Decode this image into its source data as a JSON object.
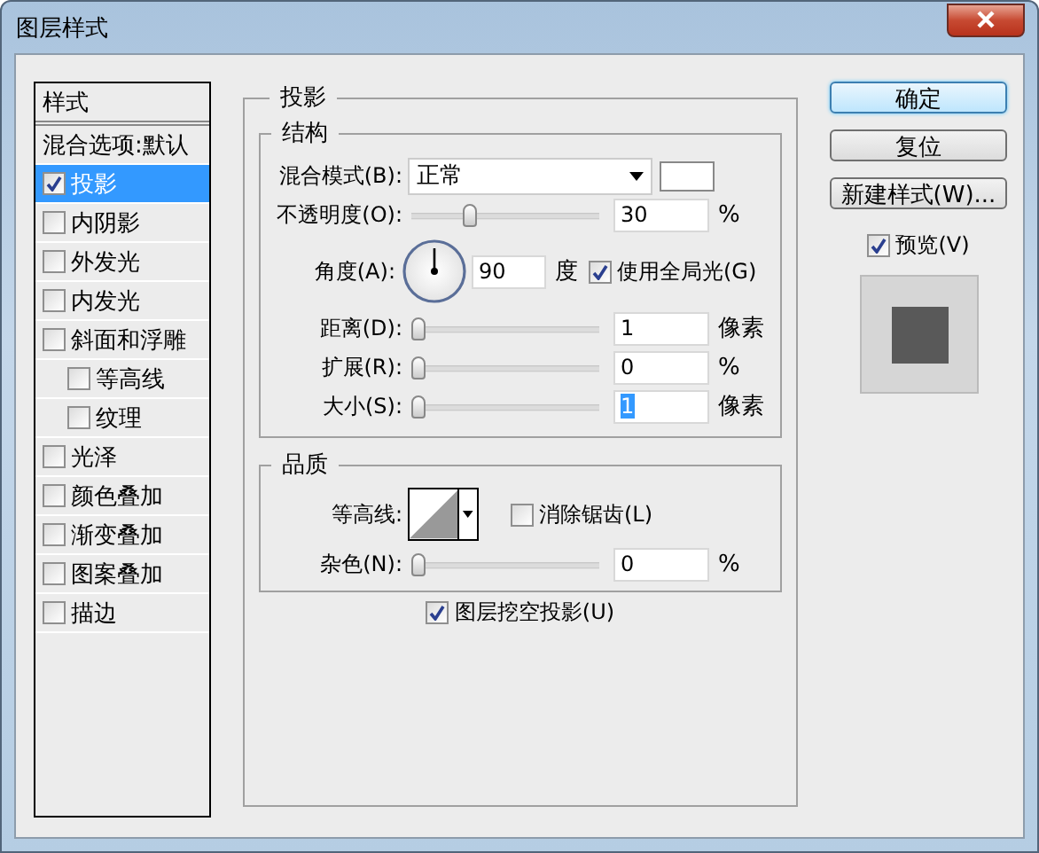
{
  "window": {
    "title": "图层样式"
  },
  "styles_panel": {
    "header": "样式",
    "items": [
      {
        "label": "混合选项:默认",
        "kind": "plain",
        "selected": false
      },
      {
        "label": "投影",
        "kind": "check",
        "checked": true,
        "selected": true
      },
      {
        "label": "内阴影",
        "kind": "check",
        "checked": false,
        "selected": false
      },
      {
        "label": "外发光",
        "kind": "check",
        "checked": false,
        "selected": false
      },
      {
        "label": "内发光",
        "kind": "check",
        "checked": false,
        "selected": false
      },
      {
        "label": "斜面和浮雕",
        "kind": "check",
        "checked": false,
        "selected": false,
        "children": [
          {
            "label": "等高线",
            "kind": "check",
            "checked": false,
            "selected": false
          },
          {
            "label": "纹理",
            "kind": "check",
            "checked": false,
            "selected": false
          }
        ]
      },
      {
        "label": "光泽",
        "kind": "check",
        "checked": false,
        "selected": false
      },
      {
        "label": "颜色叠加",
        "kind": "check",
        "checked": false,
        "selected": false
      },
      {
        "label": "渐变叠加",
        "kind": "check",
        "checked": false,
        "selected": false
      },
      {
        "label": "图案叠加",
        "kind": "check",
        "checked": false,
        "selected": false
      },
      {
        "label": "描边",
        "kind": "check",
        "checked": false,
        "selected": false
      }
    ]
  },
  "drop_shadow": {
    "title": "投影",
    "structure": {
      "title": "结构",
      "blend_mode": {
        "label": "混合模式(B):",
        "value": "正常",
        "color": "#ffffff"
      },
      "opacity": {
        "label": "不透明度(O):",
        "level": 0.3,
        "value": "30",
        "unit": "%"
      },
      "angle": {
        "label": "角度(A):",
        "value": "90",
        "unit": "度",
        "global_light": {
          "label": "使用全局光(G)",
          "checked": true
        }
      },
      "distance": {
        "label": "距离(D):",
        "level": 0,
        "value": "1",
        "unit": "像素",
        "highlighted": false
      },
      "spread": {
        "label": "扩展(R):",
        "level": 0,
        "value": "0",
        "unit": "%",
        "highlighted": false
      },
      "size": {
        "label": "大小(S):",
        "level": 0,
        "value": "1",
        "unit": "像素",
        "highlighted": true
      }
    },
    "quality": {
      "title": "品质",
      "contour": {
        "label": "等高线:"
      },
      "anti_alias": {
        "label": "消除锯齿(L)",
        "checked": false
      },
      "noise": {
        "label": "杂色(N):",
        "level": 0,
        "value": "0",
        "unit": "%",
        "highlighted": false
      }
    },
    "knockout": {
      "label": "图层挖空投影(U)",
      "checked": true
    }
  },
  "buttons": [
    {
      "label": "确定",
      "default": true
    },
    {
      "label": "复位",
      "default": false
    },
    {
      "label": "新建样式(W)...",
      "default": false
    }
  ],
  "preview": {
    "label": "预览(V)",
    "checked": true
  }
}
